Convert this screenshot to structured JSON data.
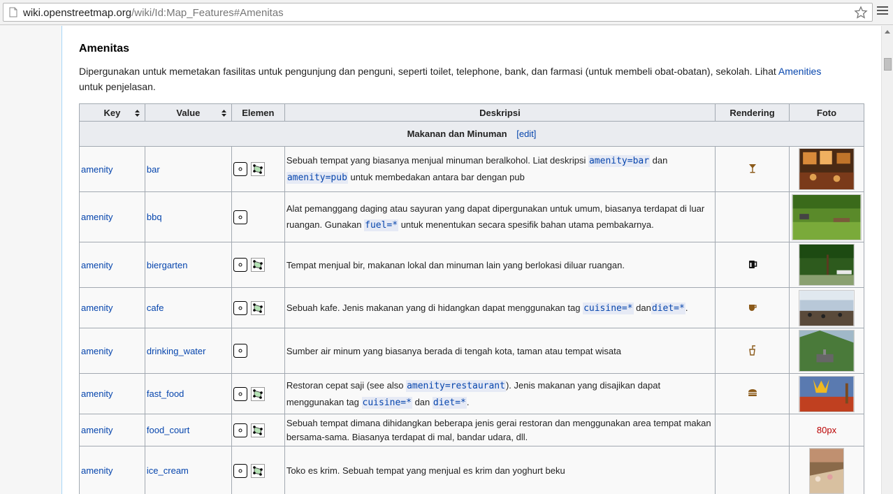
{
  "browser": {
    "url_host": "wiki.openstreetmap.org",
    "url_path": "/wiki/Id:Map_Features#Amenitas"
  },
  "section": {
    "title": "Amenitas",
    "intro_text": "Dipergunakan untuk memetakan fasilitas untuk pengunjung dan penguni, seperti toilet, telephone, bank, dan farmasi (untuk membeli obat-obatan), sekolah. Lihat ",
    "intro_link": "Amenities",
    "intro_tail": "untuk penjelasan."
  },
  "table": {
    "headers": {
      "key": "Key",
      "value": "Value",
      "element": "Elemen",
      "description": "Deskripsi",
      "rendering": "Rendering",
      "photo": "Foto"
    },
    "group": {
      "title": "Makanan dan Minuman",
      "edit": "[edit]"
    },
    "rows": [
      {
        "key": "amenity",
        "value": "bar",
        "desc_a": "Sebuah tempat yang biasanya menjual minuman beralkohol. Liat deskripsi ",
        "code_a": "amenity=bar",
        "desc_b": " dan ",
        "code_b": "amenity=pub",
        "desc_c": " untuk membedakan antara bar dengan pub"
      },
      {
        "key": "amenity",
        "value": "bbq",
        "desc_a": "Alat pemanggang daging atau sayuran yang dapat dipergunakan untuk umum, biasanya terdapat di luar ruangan. Gunakan ",
        "code_a": "fuel=*",
        "desc_b": " untuk menentukan secara spesifik bahan utama pembakarnya."
      },
      {
        "key": "amenity",
        "value": "biergarten",
        "desc_a": "Tempat menjual bir, makanan lokal dan minuman lain yang berlokasi diluar ruangan."
      },
      {
        "key": "amenity",
        "value": "cafe",
        "desc_a": "Sebuah kafe. Jenis makanan yang di hidangkan dapat menggunakan tag ",
        "code_a": "cuisine=*",
        "desc_b": " dan",
        "code_b": "diet=*",
        "desc_c": "."
      },
      {
        "key": "amenity",
        "value": "drinking_water",
        "desc_a": "Sumber air minum yang biasanya berada di tengah kota, taman atau tempat wisata"
      },
      {
        "key": "amenity",
        "value": "fast_food",
        "desc_a": "Restoran cepat saji (see also ",
        "code_a": "amenity=restaurant",
        "desc_b": "). Jenis makanan yang disajikan dapat menggunakan tag ",
        "code_b": "cuisine=*",
        "desc_c": " dan ",
        "code_c": "diet=*",
        "desc_d": "."
      },
      {
        "key": "amenity",
        "value": "food_court",
        "desc_a": "Sebuah tempat dimana dihidangkan beberapa jenis gerai restoran dan menggunakan area tempat makan bersama-sama. Biasanya terdapat di mal, bandar udara, dll.",
        "photo_missing": "80px"
      },
      {
        "key": "amenity",
        "value": "ice_cream",
        "desc_a": "Toko es krim. Sebuah tempat yang menjual es krim dan yoghurt beku"
      }
    ]
  },
  "colors": {
    "link": "#0645ad",
    "header_bg": "#eaecf0",
    "border": "#a2a9b1",
    "render_icon": "#8b5a1a"
  }
}
